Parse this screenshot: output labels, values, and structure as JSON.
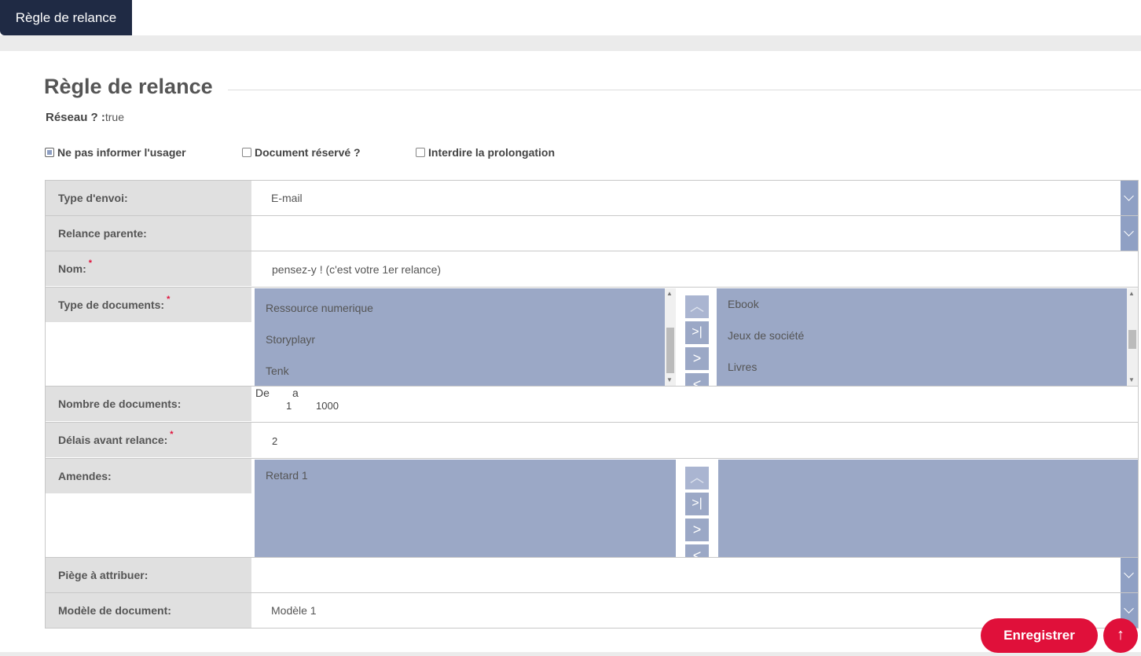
{
  "tab": {
    "label": "Règle de relance"
  },
  "page": {
    "title": "Règle de relance"
  },
  "reseau": {
    "label": "Réseau ? :",
    "value": "true"
  },
  "options": [
    {
      "label": "Ne pas informer l'usager",
      "checked": true
    },
    {
      "label": "Document réservé ?",
      "checked": false
    },
    {
      "label": "Interdire la prolongation",
      "checked": false
    }
  ],
  "fields": {
    "type_envoi": {
      "label": "Type d'envoi:",
      "value": "E-mail"
    },
    "relance_parente": {
      "label": "Relance parente:",
      "value": ""
    },
    "nom": {
      "label": "Nom:",
      "required": "*",
      "value": "pensez-y !  (c'est votre 1er relance)"
    },
    "type_documents": {
      "label": "Type de documents:",
      "required": "*",
      "available": [
        "Ressource numerique",
        "Storyplayr",
        "Tenk"
      ],
      "selected": [
        "Ebook",
        "Jeux de société",
        "Livres"
      ]
    },
    "nombre_documents": {
      "label": "Nombre de documents:",
      "de_label": "De",
      "a_label": "a",
      "de_value": "1",
      "a_value": "1000"
    },
    "delais": {
      "label": "Délais avant relance:",
      "required": "*",
      "value": "2"
    },
    "amendes": {
      "label": "Amendes:",
      "available": [
        "Retard 1"
      ],
      "selected": []
    },
    "piege": {
      "label": "Piège à attribuer:",
      "value": ""
    },
    "modele": {
      "label": "Modèle de document:",
      "value": "Modèle 1"
    }
  },
  "buttons": {
    "save": "Enregistrer",
    "scroll_top": "↑"
  },
  "icons": {
    "dropdown": "chevron-down-icon",
    "move_up": "chevron-up-icon",
    "move_all": "move-all-right-icon",
    "move_right": "chevron-right-icon",
    "move_left": "chevron-left-icon"
  },
  "colors": {
    "accent": "#e0103a",
    "tab_bg": "#1f2a44",
    "list_bg": "#9ba8c6"
  }
}
